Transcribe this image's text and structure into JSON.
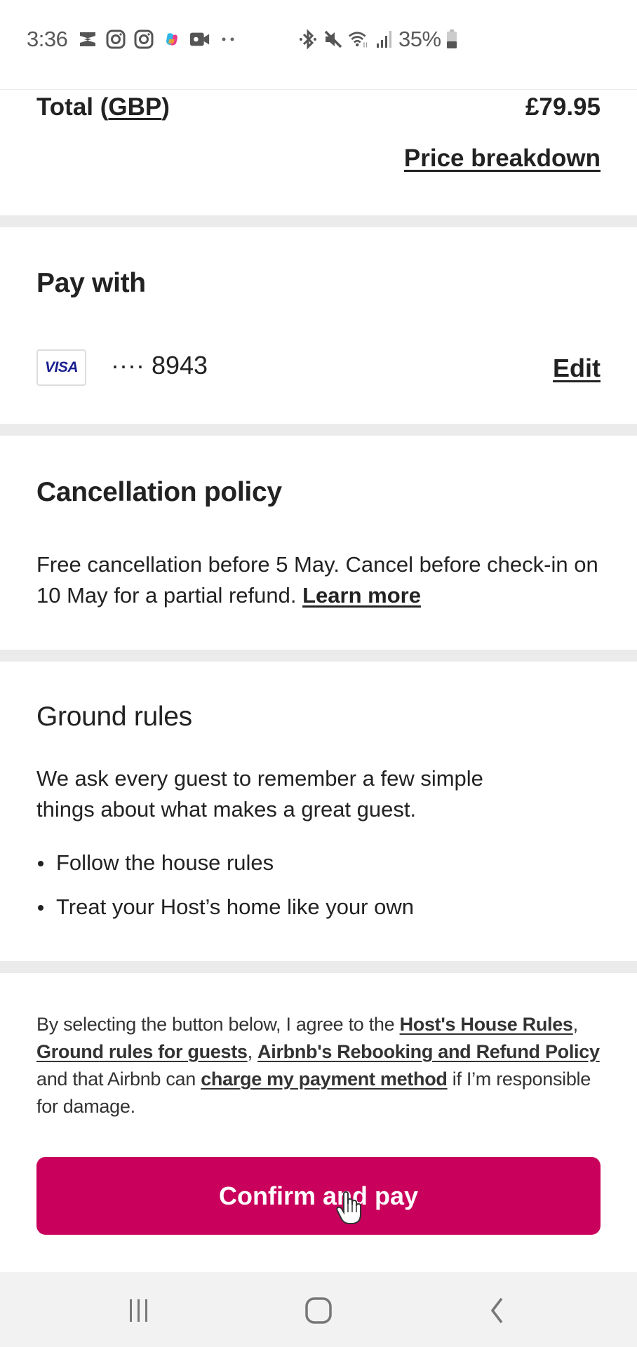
{
  "status_bar": {
    "time": "3:36",
    "battery_percent": "35%",
    "notification_icons": [
      "capcut-icon",
      "instagram-icon",
      "instagram-icon",
      "copilot-icon",
      "video-camera-icon",
      "more-dots-icon"
    ],
    "system_icons": [
      "bluetooth-icon",
      "mute-icon",
      "wifi-icon",
      "signal-icon",
      "battery-icon"
    ]
  },
  "total": {
    "label_prefix": "Total (",
    "currency": "GBP",
    "label_suffix": ")",
    "amount": "£79.95",
    "price_breakdown_link": "Price breakdown"
  },
  "pay_with": {
    "title": "Pay with",
    "card_brand": "VISA",
    "card_number": "···· 8943",
    "edit_label": "Edit"
  },
  "cancellation": {
    "title": "Cancellation policy",
    "text": "Free cancellation before 5 May. Cancel before check-in on 10 May for a partial refund. ",
    "learn_more": "Learn more"
  },
  "ground_rules": {
    "title": "Ground rules",
    "intro": "We ask every guest to remember a few simple things about what makes a great guest.",
    "items": [
      "Follow the house rules",
      "Treat your Host’s home like your own"
    ]
  },
  "agreement": {
    "part1": "By selecting the button below, I agree to the ",
    "link_house_rules": "Host's House Rules",
    "sep1": ", ",
    "link_ground_rules": "Ground rules for guests",
    "sep2": ", ",
    "link_rebooking": "Airbnb's Rebooking and Refund Policy",
    "part2": " and that Airbnb can ",
    "link_charge": "charge my payment method",
    "part3": " if I’m responsible for damage."
  },
  "confirm_button": {
    "label": "Confirm and pay",
    "color": "#c9005c"
  },
  "nav_bar": {
    "buttons": [
      "recent-apps",
      "home",
      "back"
    ]
  }
}
